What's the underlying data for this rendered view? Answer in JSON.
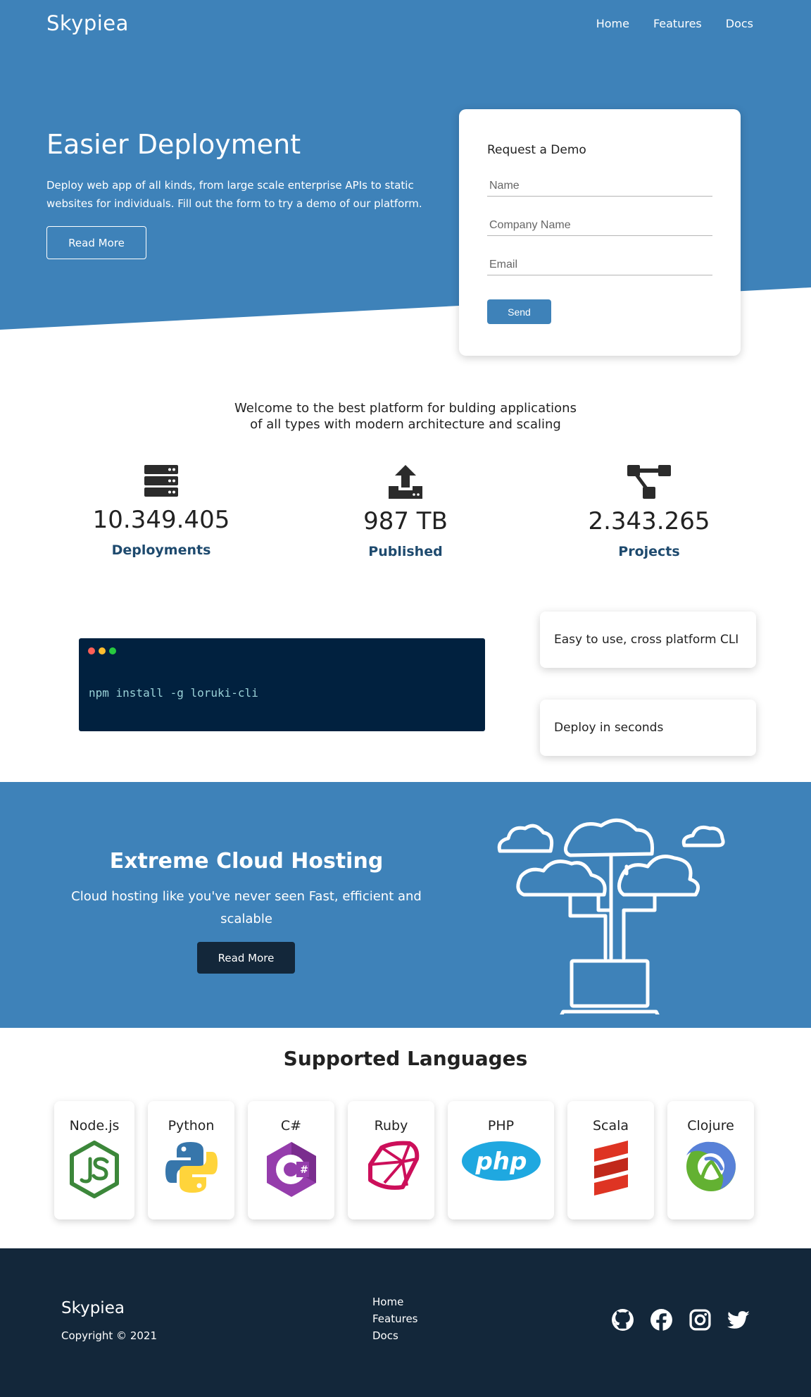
{
  "header": {
    "logo": "Skypiea",
    "nav": [
      "Home",
      "Features",
      "Docs"
    ]
  },
  "hero": {
    "title": "Easier Deployment",
    "text": "Deploy web app of all kinds, from large scale enterprise APIs to static websites for individuals. Fill out the form to try a demo of our platform.",
    "button": "Read More"
  },
  "demo_form": {
    "title": "Request a Demo",
    "name_placeholder": "Name",
    "company_placeholder": "Company Name",
    "email_placeholder": "Email",
    "send_label": "Send"
  },
  "welcome": "Welcome to the best platform for bulding applications of all types with modern architecture and scaling",
  "stats": [
    {
      "icon": "server-icon",
      "value": "10.349.405",
      "label": "Deployments"
    },
    {
      "icon": "upload-icon",
      "value": "987 TB",
      "label": "Published"
    },
    {
      "icon": "project-diagram-icon",
      "value": "2.343.265",
      "label": "Projects"
    }
  ],
  "terminal": {
    "command": "npm install -g loruki-cli",
    "dot_colors": [
      "#ff5f56",
      "#ffbd2e",
      "#27c93f"
    ]
  },
  "features": [
    "Easy to use, cross platform CLI",
    "Deploy in seconds"
  ],
  "cloud": {
    "title": "Extreme Cloud Hosting",
    "text": "Cloud hosting like you've never seen Fast, efficient and scalable",
    "button": "Read More"
  },
  "languages": {
    "title": "Supported Languages",
    "items": [
      {
        "name": "Node.js",
        "icon": "nodejs-icon"
      },
      {
        "name": "Python",
        "icon": "python-icon"
      },
      {
        "name": "C#",
        "icon": "csharp-icon"
      },
      {
        "name": "Ruby",
        "icon": "ruby-icon"
      },
      {
        "name": "PHP",
        "icon": "php-icon"
      },
      {
        "name": "Scala",
        "icon": "scala-icon"
      },
      {
        "name": "Clojure",
        "icon": "clojure-icon"
      }
    ]
  },
  "footer": {
    "brand": "Skypiea",
    "copyright": "Copyright © 2021",
    "links": [
      "Home",
      "Features",
      "Docs"
    ],
    "socials": [
      "github-icon",
      "facebook-icon",
      "instagram-icon",
      "twitter-icon"
    ]
  },
  "colors": {
    "primary": "#3e82b9",
    "dark": "#13273a",
    "terminal_bg": "#01213f",
    "stat_label": "#1e4a6e"
  }
}
